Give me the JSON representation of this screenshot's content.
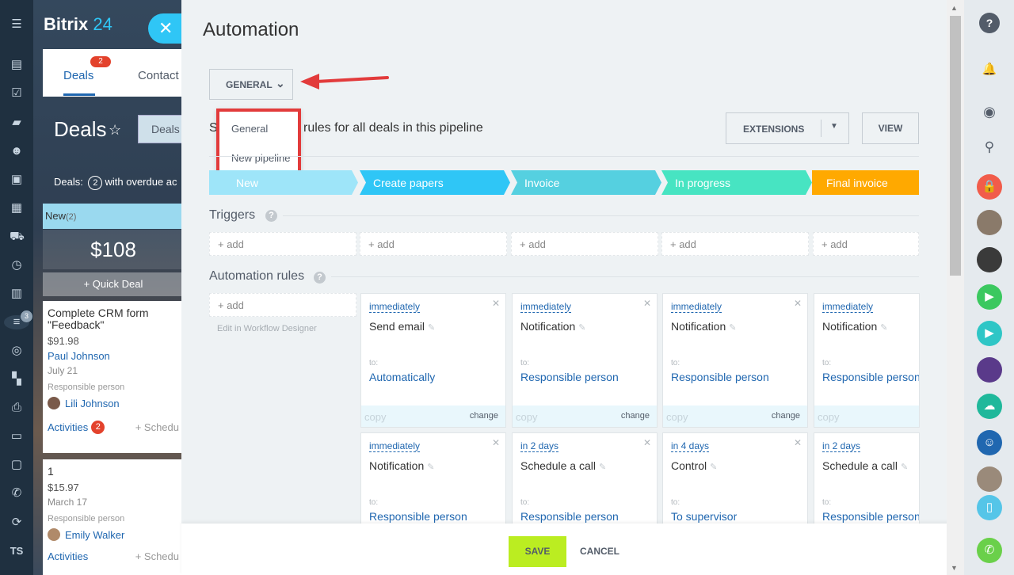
{
  "app": {
    "logo_main": "Bitrix",
    "logo_num": "24",
    "close_glyph": "✕"
  },
  "left_rail": {
    "items": [
      "menu-icon",
      "feed-icon",
      "tasks-icon",
      "chat-icon",
      "groups-icon",
      "contacts-icon",
      "calendar-icon",
      "shop-icon",
      "time-icon",
      "docs-icon",
      "crm-icon",
      "target-icon",
      "apps-icon",
      "printer-icon",
      "drive-icon",
      "window-icon",
      "phone-icon",
      "sync-icon"
    ],
    "crm_badge": "3",
    "user_initials": "TS"
  },
  "crm": {
    "tabs": {
      "deals": "Deals",
      "deals_badge": "2",
      "contacts": "Contact"
    },
    "title": "Deals",
    "deals_tab2": "Deals",
    "overdue_prefix": "Deals:",
    "overdue_count": "2",
    "overdue_suffix": "with overdue ac",
    "stage_new": "New",
    "stage_new_count": "(2)",
    "stage_sum": "$108",
    "quick_deal": "+ Quick Deal",
    "cards": [
      {
        "title": "Complete CRM form \"Feedback\"",
        "price": "$91.98",
        "contact": "Paul Johnson",
        "date": "July 21",
        "resp_label": "Responsible person",
        "resp_name": "Lili Johnson",
        "activities": "Activities",
        "activities_badge": "2",
        "schedule": "+ Schedu"
      },
      {
        "title": "1",
        "price": "$15.97",
        "contact": "",
        "date": "March 17",
        "resp_label": "Responsible person",
        "resp_name": "Emily Walker",
        "activities": "Activities",
        "activities_badge": "",
        "schedule": "+ Schedu"
      }
    ]
  },
  "panel": {
    "title": "Automation",
    "pipeline_button": "GENERAL",
    "dropdown": [
      "General",
      "New pipeline"
    ],
    "desc_first": "S",
    "desc_rest": "rules for all deals in this pipeline",
    "extensions_button": "EXTENSIONS",
    "view_button": "VIEW",
    "stages": [
      {
        "name": "New",
        "color": "#9ee5f9"
      },
      {
        "name": "Create papers",
        "color": "#2fc6f6"
      },
      {
        "name": "Invoice",
        "color": "#55d0e0"
      },
      {
        "name": "In progress",
        "color": "#47e4c2"
      },
      {
        "name": "Final invoice",
        "color": "#ffa900"
      }
    ],
    "triggers_title": "Triggers",
    "automation_title": "Automation rules",
    "add_label": "+ add",
    "edit_designer": "Edit in Workflow Designer",
    "to_label": "to:",
    "copy_label": "copy",
    "change_label": "change",
    "rules_row1": [
      {
        "when": "immediately",
        "name": "Send email",
        "target": "Automatically"
      },
      {
        "when": "immediately",
        "name": "Notification",
        "target": "Responsible person"
      },
      {
        "when": "immediately",
        "name": "Notification",
        "target": "Responsible person"
      },
      {
        "when": "immediately",
        "name": "Notification",
        "target": "Responsible person"
      }
    ],
    "rules_row2": [
      {
        "when": "immediately",
        "name": "Notification",
        "target": "Responsible person"
      },
      {
        "when": "in 2 days",
        "name": "Schedule a call",
        "target": "Responsible person"
      },
      {
        "when": "in 4 days",
        "name": "Control",
        "target": "To supervisor"
      },
      {
        "when": "in 2 days",
        "name": "Schedule a call",
        "target": "Responsible person"
      }
    ],
    "save_button": "SAVE",
    "cancel_button": "CANCEL"
  },
  "right_rail": {
    "items": [
      {
        "icon": "help-icon",
        "color": "#535c69"
      },
      {
        "icon": "bell-icon",
        "color": "#535c69"
      },
      {
        "icon": "chat-bubble-icon",
        "color": "#535c69"
      },
      {
        "icon": "search-icon",
        "color": "#535c69"
      },
      {
        "icon": "lock-icon",
        "color": "#f15c4a"
      },
      {
        "icon": "avatar-icon",
        "color": "#8a7a6a"
      },
      {
        "icon": "avatar-icon",
        "color": "#3a3a3a"
      },
      {
        "icon": "video-call-icon",
        "color": "#3bc85f"
      },
      {
        "icon": "video-call-icon",
        "color": "#2fc6c6"
      },
      {
        "icon": "avatar-icon",
        "color": "#5a3a8a"
      },
      {
        "icon": "cloud-icon",
        "color": "#1fb89b"
      },
      {
        "icon": "group-icon",
        "color": "#2067b0"
      },
      {
        "icon": "avatar-icon",
        "color": "#9a8a7a"
      },
      {
        "icon": "mobile-icon",
        "color": "#55c5e8"
      },
      {
        "icon": "phone-icon",
        "color": "#6ad04a"
      }
    ]
  }
}
